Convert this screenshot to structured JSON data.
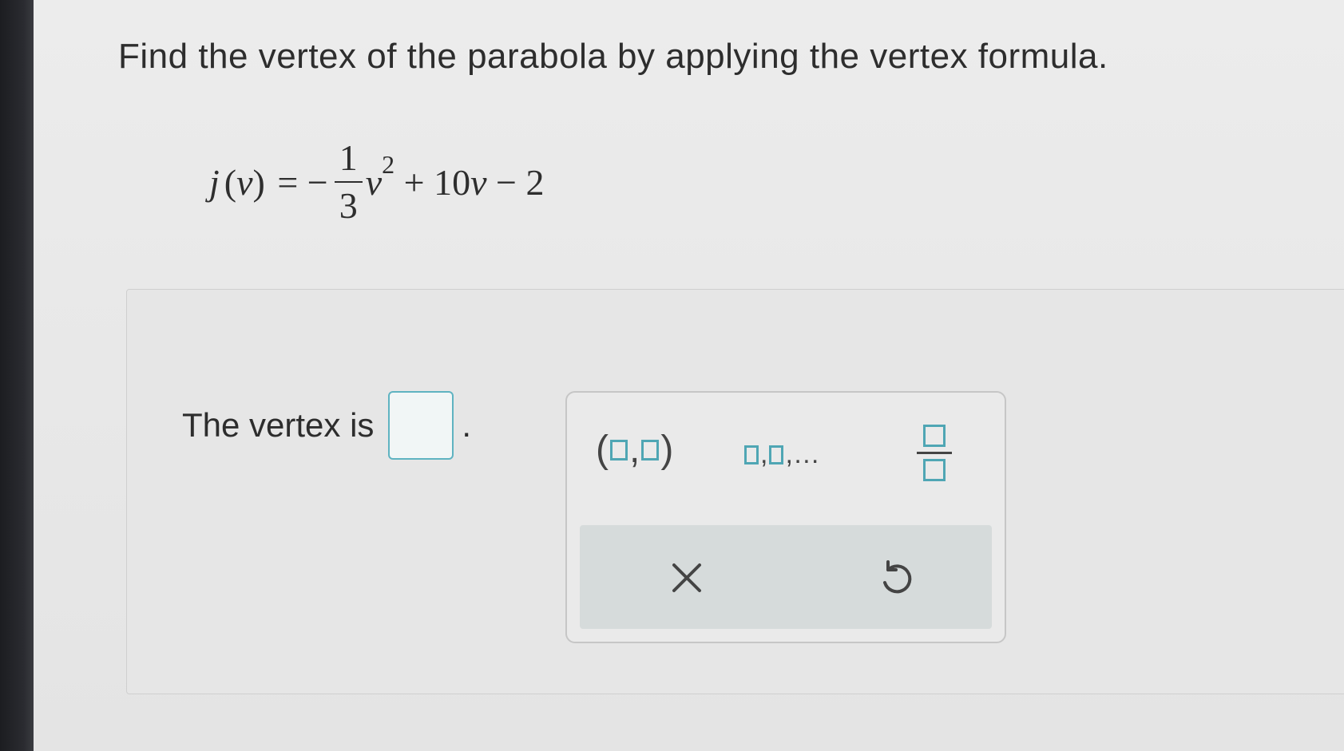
{
  "question": {
    "prompt": "Find the vertex of the parabola by applying the vertex formula.",
    "equation": {
      "func": "j",
      "var": "v",
      "lhs_open": "(",
      "lhs_close": ")",
      "equals": " = −",
      "frac_num": "1",
      "frac_den": "3",
      "exponent": "2",
      "rest": " + 10",
      "rest_end": " − 2"
    }
  },
  "answer": {
    "label": "The vertex is",
    "period": ".",
    "value": ""
  },
  "palette": {
    "ordered_pair": {
      "open": "(",
      "comma": ",",
      "close": ")"
    },
    "list": {
      "sep": ",",
      "ellipsis": "…"
    },
    "icons": {
      "clear": "close-icon",
      "undo": "undo-icon"
    },
    "accent_color": "#4fa6b4"
  }
}
